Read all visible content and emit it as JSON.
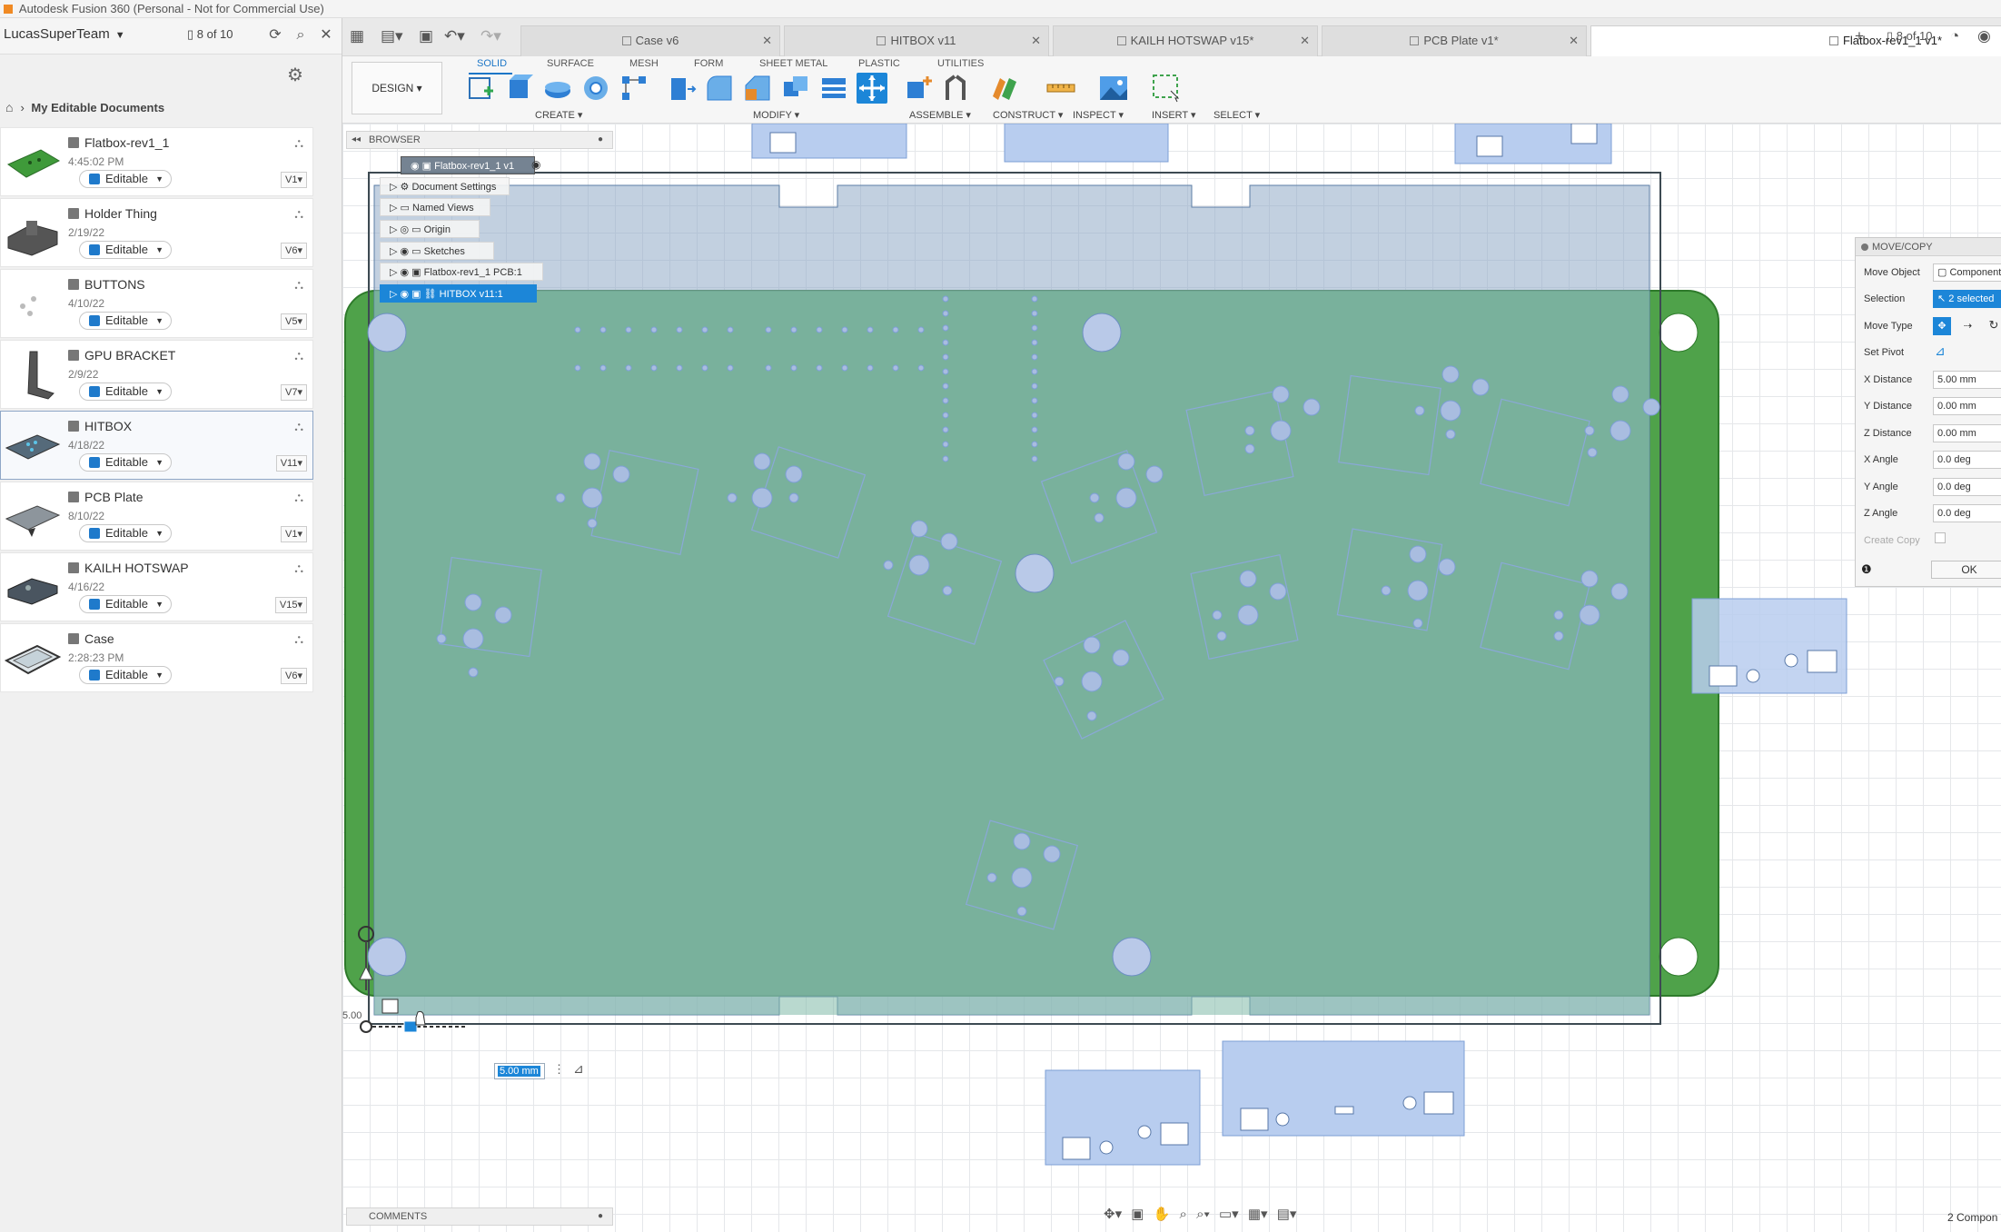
{
  "window": {
    "title": "Autodesk Fusion 360 (Personal - Not for Commercial Use)"
  },
  "data_panel": {
    "team": "LucasSuperTeam",
    "count": "8 of 10",
    "breadcrumb": "My Editable Documents",
    "docs": [
      {
        "name": "Flatbox-rev1_1",
        "date": "4:45:02 PM",
        "status": "Editable",
        "version": "V1"
      },
      {
        "name": "Holder Thing",
        "date": "2/19/22",
        "status": "Editable",
        "version": "V6"
      },
      {
        "name": "BUTTONS",
        "date": "4/10/22",
        "status": "Editable",
        "version": "V5"
      },
      {
        "name": "GPU BRACKET",
        "date": "2/9/22",
        "status": "Editable",
        "version": "V7"
      },
      {
        "name": "HITBOX",
        "date": "4/18/22",
        "status": "Editable",
        "version": "V11"
      },
      {
        "name": "PCB Plate",
        "date": "8/10/22",
        "status": "Editable",
        "version": "V1"
      },
      {
        "name": "KAILH HOTSWAP",
        "date": "4/16/22",
        "status": "Editable",
        "version": "V15"
      },
      {
        "name": "Case",
        "date": "2:28:23 PM",
        "status": "Editable",
        "version": "V6"
      }
    ]
  },
  "tabs": [
    {
      "label": "Case v6",
      "active": false
    },
    {
      "label": "HITBOX v11",
      "active": false
    },
    {
      "label": "KAILH HOTSWAP v15*",
      "active": false
    },
    {
      "label": "PCB Plate v1*",
      "active": false
    },
    {
      "label": "Flatbox-rev1_1 v1*",
      "active": true
    }
  ],
  "tab_count": "8 of 10",
  "toolbar": {
    "design": "DESIGN",
    "workspaces": [
      "SOLID",
      "SURFACE",
      "MESH",
      "FORM",
      "SHEET METAL",
      "PLASTIC",
      "UTILITIES"
    ],
    "groups": [
      "CREATE",
      "MODIFY",
      "ASSEMBLE",
      "CONSTRUCT",
      "INSPECT",
      "INSERT",
      "SELECT"
    ]
  },
  "browser": {
    "title": "BROWSER",
    "root": "Flatbox-rev1_1 v1",
    "nodes": [
      "Document Settings",
      "Named Views",
      "Origin",
      "Sketches",
      "Flatbox-rev1_1 PCB:1",
      "HITBOX v11:1"
    ]
  },
  "move_copy": {
    "title": "MOVE/COPY",
    "labels": [
      "Move Object",
      "Selection",
      "Move Type",
      "Set Pivot",
      "X Distance",
      "Y Distance",
      "Z Distance",
      "X Angle",
      "Y Angle",
      "Z Angle",
      "Create Copy"
    ],
    "move_object": "Component",
    "selection": "2 selected",
    "x_distance": "5.00 mm",
    "y_distance": "0.00 mm",
    "z_distance": "0.00 mm",
    "x_angle": "0.0 deg",
    "y_angle": "0.0 deg",
    "z_angle": "0.0 deg",
    "ok": "OK"
  },
  "canvas": {
    "distance_input": "5.00 mm",
    "dim_label": "5.00"
  },
  "comments": "COMMENTS",
  "status_right": "2 Compon"
}
